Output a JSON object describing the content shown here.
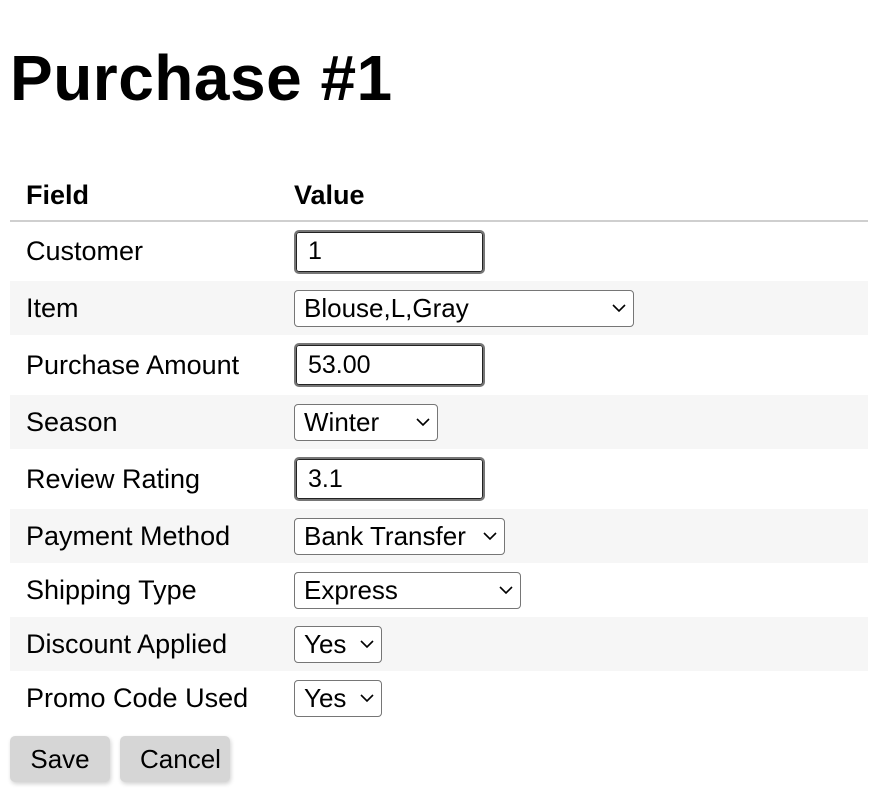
{
  "page": {
    "title": "Purchase #1"
  },
  "table": {
    "headers": {
      "field": "Field",
      "value": "Value"
    },
    "rows": {
      "customer": {
        "label": "Customer",
        "value": "1"
      },
      "item": {
        "label": "Item",
        "value": "Blouse,L,Gray"
      },
      "purchase_amount": {
        "label": "Purchase Amount",
        "value": "53.00"
      },
      "season": {
        "label": "Season",
        "value": "Winter"
      },
      "review_rating": {
        "label": "Review Rating",
        "value": "3.1"
      },
      "payment_method": {
        "label": "Payment Method",
        "value": "Bank Transfer"
      },
      "shipping_type": {
        "label": "Shipping Type",
        "value": "Express"
      },
      "discount_applied": {
        "label": "Discount Applied",
        "value": "Yes"
      },
      "promo_code_used": {
        "label": "Promo Code Used",
        "value": "Yes"
      }
    }
  },
  "actions": {
    "save_label": "Save",
    "cancel_label": "Cancel"
  },
  "colors": {
    "shaded_row": "#f6f6f6",
    "button_bg": "#d6d6d6",
    "header_rule": "#cfcfcf"
  },
  "icons": {
    "select_arrow": "chevron-down-icon"
  }
}
